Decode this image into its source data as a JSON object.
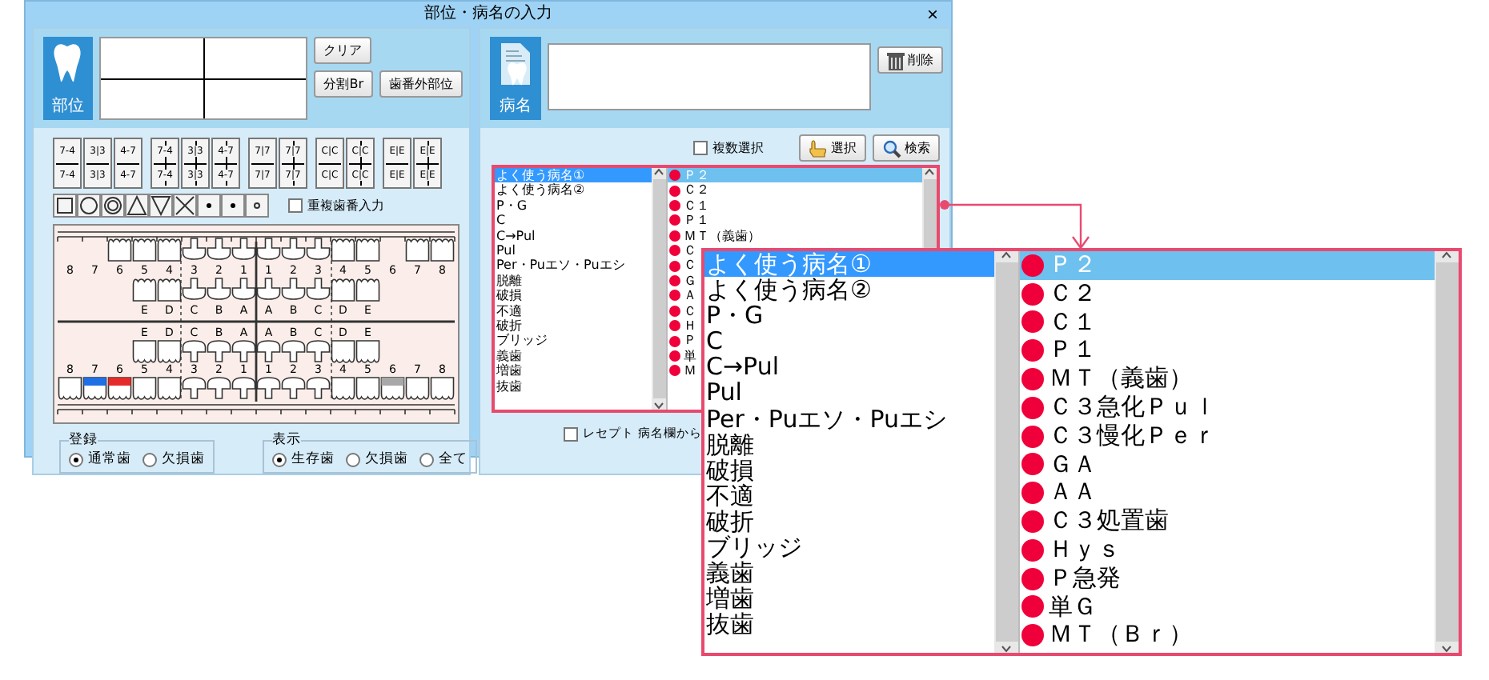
{
  "window": {
    "title": "部位・病名の入力",
    "close": "×"
  },
  "site": {
    "label": "部位",
    "buttons": [
      "クリア",
      "分割Br",
      "歯番外部位"
    ],
    "range_buttons": [
      {
        "kind": "pair",
        "top": "7-4",
        "bottom": "7-4"
      },
      {
        "kind": "pair",
        "top": "3|3",
        "bottom": "3|3"
      },
      {
        "kind": "pair",
        "top": "4-7",
        "bottom": "4-7"
      },
      {
        "kind": "cross",
        "top": "7-4",
        "bottom": "7-4"
      },
      {
        "kind": "cross",
        "top": "3|3",
        "bottom": "3|3"
      },
      {
        "kind": "cross",
        "top": "4-7",
        "bottom": "4-7"
      },
      {
        "kind": "pair",
        "top": "7|7",
        "bottom": "7|7"
      },
      {
        "kind": "cross",
        "top": "7|7",
        "bottom": "7|7"
      },
      {
        "kind": "pair",
        "top": "C|C",
        "bottom": "C|C"
      },
      {
        "kind": "cross",
        "top": "C|C",
        "bottom": "C|C"
      },
      {
        "kind": "pair",
        "top": "E|E",
        "bottom": "E|E"
      },
      {
        "kind": "cross",
        "top": "E|E",
        "bottom": "E|E"
      }
    ],
    "duplicate_input": {
      "label": "重複歯番入力",
      "checked": false
    }
  },
  "dental_chart": {
    "upper_teeth": [
      {
        "number": "8",
        "present": false
      },
      {
        "number": "7",
        "present": false
      },
      {
        "number": "6",
        "present": true
      },
      {
        "number": "5",
        "present": true
      },
      {
        "number": "4",
        "present": true
      },
      {
        "number": "3",
        "present": true
      },
      {
        "number": "2",
        "present": true
      },
      {
        "number": "1",
        "present": true
      },
      {
        "number": "1",
        "present": true
      },
      {
        "number": "2",
        "present": true
      },
      {
        "number": "3",
        "present": true
      },
      {
        "number": "4",
        "present": true
      },
      {
        "number": "5",
        "present": true
      },
      {
        "number": "6",
        "present": false
      },
      {
        "number": "7",
        "present": true
      },
      {
        "number": "8",
        "present": true
      }
    ],
    "upper_primary": [
      "E",
      "D",
      "C",
      "B",
      "A",
      "A",
      "B",
      "C",
      "D",
      "E"
    ],
    "lower_primary": [
      "E",
      "D",
      "C",
      "B",
      "A",
      "A",
      "B",
      "C",
      "D",
      "E"
    ],
    "lower_teeth": [
      {
        "number": "8"
      },
      {
        "number": "7",
        "color": "#1f6fe5"
      },
      {
        "number": "6",
        "color": "#e52a2a"
      },
      {
        "number": "5"
      },
      {
        "number": "4"
      },
      {
        "number": "3"
      },
      {
        "number": "2"
      },
      {
        "number": "1"
      },
      {
        "number": "1"
      },
      {
        "number": "2"
      },
      {
        "number": "3"
      },
      {
        "number": "4"
      },
      {
        "number": "5"
      },
      {
        "number": "6",
        "color": "#a8a8a8"
      },
      {
        "number": "7"
      },
      {
        "number": "8"
      }
    ]
  },
  "register": {
    "title": "登録",
    "options": [
      {
        "label": "通常歯",
        "selected": true
      },
      {
        "label": "欠損歯",
        "selected": false
      }
    ]
  },
  "display": {
    "title": "表示",
    "options": [
      {
        "label": "生存歯",
        "selected": true
      },
      {
        "label": "欠損歯",
        "selected": false
      },
      {
        "label": "全て",
        "selected": false
      }
    ]
  },
  "disease": {
    "label": "病名",
    "delete_button": "削除",
    "multi_select": {
      "label": "複数選択",
      "checked": false
    },
    "select_button": "選択",
    "search_button": "検索",
    "categories": [
      {
        "label": "よく使う病名①",
        "selected": true
      },
      {
        "label": "よく使う病名②",
        "selected": false
      },
      {
        "label": "P・G",
        "selected": false
      },
      {
        "label": "C",
        "selected": false
      },
      {
        "label": "C→Pul",
        "selected": false
      },
      {
        "label": "Pul",
        "selected": false
      },
      {
        "label": "Per・Puエソ・Puエシ",
        "selected": false
      },
      {
        "label": "脱離",
        "selected": false
      },
      {
        "label": "破損",
        "selected": false
      },
      {
        "label": "不適",
        "selected": false
      },
      {
        "label": "破折",
        "selected": false
      },
      {
        "label": "ブリッジ",
        "selected": false
      },
      {
        "label": "義歯",
        "selected": false
      },
      {
        "label": "増歯",
        "selected": false
      },
      {
        "label": "抜歯",
        "selected": false
      }
    ],
    "names": [
      {
        "label": "Ｐ２",
        "selected": true
      },
      {
        "label": "Ｃ２",
        "selected": false
      },
      {
        "label": "Ｃ１",
        "selected": false
      },
      {
        "label": "Ｐ１",
        "selected": false
      },
      {
        "label": "ＭＴ（義歯）",
        "selected": false
      },
      {
        "label": "Ｃ",
        "selected": false
      },
      {
        "label": "Ｃ",
        "selected": false
      },
      {
        "label": "Ｇ",
        "selected": false
      },
      {
        "label": "Ａ",
        "selected": false
      },
      {
        "label": "Ｃ",
        "selected": false
      },
      {
        "label": "Ｈ",
        "selected": false
      },
      {
        "label": "Ｐ",
        "selected": false
      },
      {
        "label": "単",
        "selected": false
      },
      {
        "label": "Ｍ",
        "selected": false
      }
    ],
    "receipt_check": {
      "label": "レセプト 病名欄から",
      "checked": false
    }
  },
  "zoom_popup": {
    "categories": [
      {
        "label": "よく使う病名①",
        "selected": true
      },
      {
        "label": "よく使う病名②",
        "selected": false
      },
      {
        "label": "P・G",
        "selected": false
      },
      {
        "label": "C",
        "selected": false
      },
      {
        "label": "C→Pul",
        "selected": false
      },
      {
        "label": "Pul",
        "selected": false
      },
      {
        "label": "Per・Puエソ・Puエシ",
        "selected": false
      },
      {
        "label": "脱離",
        "selected": false
      },
      {
        "label": "破損",
        "selected": false
      },
      {
        "label": "不適",
        "selected": false
      },
      {
        "label": "破折",
        "selected": false
      },
      {
        "label": "ブリッジ",
        "selected": false
      },
      {
        "label": "義歯",
        "selected": false
      },
      {
        "label": "増歯",
        "selected": false
      },
      {
        "label": "抜歯",
        "selected": false
      }
    ],
    "names": [
      {
        "label": "Ｐ２",
        "selected": true
      },
      {
        "label": "Ｃ２",
        "selected": false
      },
      {
        "label": "Ｃ１",
        "selected": false
      },
      {
        "label": "Ｐ１",
        "selected": false
      },
      {
        "label": "ＭＴ（義歯）",
        "selected": false
      },
      {
        "label": "Ｃ３急化Ｐｕｌ",
        "selected": false
      },
      {
        "label": "Ｃ３慢化Ｐｅｒ",
        "selected": false
      },
      {
        "label": "ＧＡ",
        "selected": false
      },
      {
        "label": "ＡＡ",
        "selected": false
      },
      {
        "label": "Ｃ３処置歯",
        "selected": false
      },
      {
        "label": "Ｈｙｓ",
        "selected": false
      },
      {
        "label": "Ｐ急発",
        "selected": false
      },
      {
        "label": "単Ｇ",
        "selected": false
      },
      {
        "label": "ＭＴ（Ｂｒ）",
        "selected": false
      }
    ]
  }
}
